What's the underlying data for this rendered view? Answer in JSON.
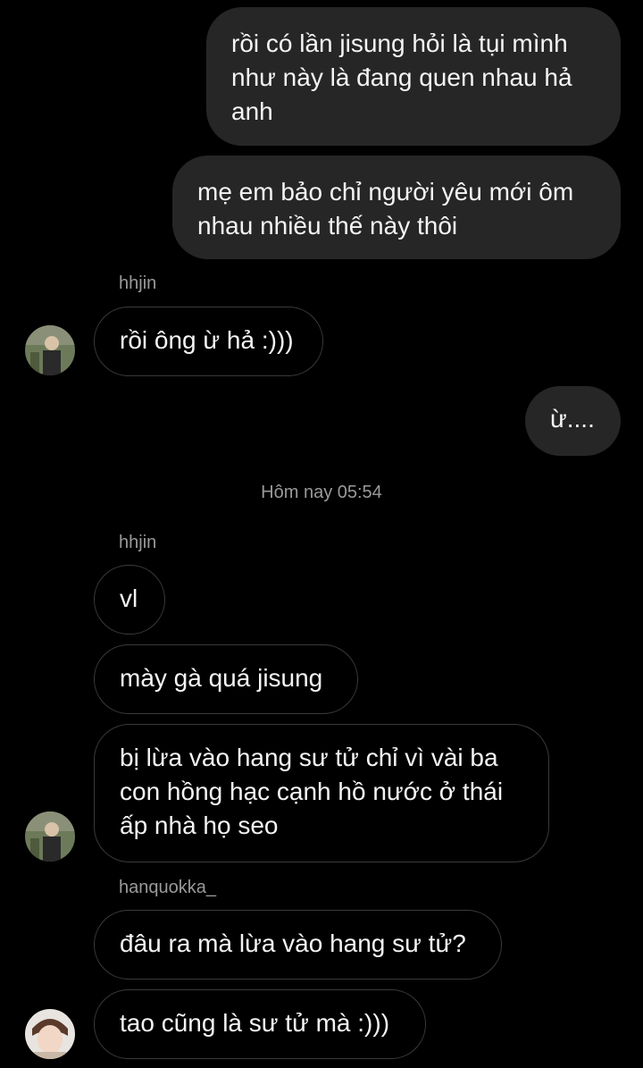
{
  "chat": {
    "messages": [
      {
        "side": "sent",
        "text": "rồi có lần jisung hỏi là tụi mình\nnhư này là đang quen nhau hả\nanh"
      },
      {
        "side": "sent",
        "text": "mẹ em bảo chỉ người yêu mới ôm\nnhau nhiều thế này thôi"
      },
      {
        "side": "recv",
        "sender": "hhjin",
        "text": "rồi ông ừ hả :)))"
      },
      {
        "side": "sent",
        "text": "ừ...."
      },
      {
        "side": "recv",
        "sender": "hhjin",
        "text": "vl"
      },
      {
        "side": "recv",
        "text": "mày gà quá jisung"
      },
      {
        "side": "recv",
        "text": "bị lừa vào hang sư tử chỉ vì vài ba\ncon hồng hạc cạnh hồ nước ở thái\nấp nhà họ seo"
      },
      {
        "side": "recv",
        "sender": "hanquokka_",
        "text": "đâu ra mà lừa vào hang sư tử?"
      },
      {
        "side": "recv",
        "text": "tao cũng là sư tử mà :)))"
      }
    ],
    "timestamp": "Hôm nay 05:54"
  }
}
